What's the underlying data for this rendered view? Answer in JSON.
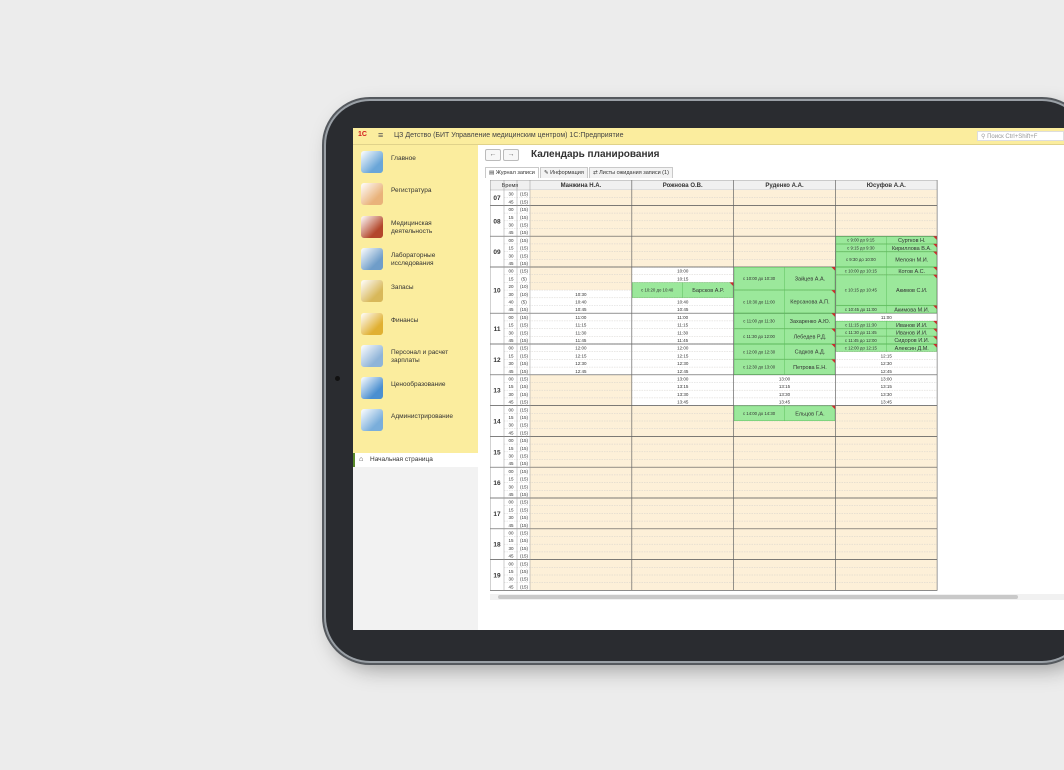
{
  "app": {
    "title": "ЦЗ Детство (БИТ Управление медицинским центром) 1С:Предприятие",
    "search_placeholder": "Поиск Ctrl+Shift+F",
    "logo_text": "1С"
  },
  "sidebar": {
    "items": [
      {
        "label": "Главное",
        "icon": "home-dashboard-icon",
        "color": "#6aa6d8"
      },
      {
        "label": "Регистратура",
        "icon": "nurse-icon",
        "color": "#e9b27a"
      },
      {
        "label": "Медицинская деятельность",
        "icon": "medical-case-icon",
        "color": "#b3472b"
      },
      {
        "label": "Лабораторные исследования",
        "icon": "lab-flask-icon",
        "color": "#6f9dc9"
      },
      {
        "label": "Запасы",
        "icon": "box-icon",
        "color": "#d8b85a"
      },
      {
        "label": "Финансы",
        "icon": "coins-icon",
        "color": "#e0b032"
      },
      {
        "label": "Персонал и расчет зарплаты",
        "icon": "staff-icon",
        "color": "#8fb4d8"
      },
      {
        "label": "Ценообразование",
        "icon": "price-chart-icon",
        "color": "#4b8fd0"
      },
      {
        "label": "Администрирование",
        "icon": "admin-settings-icon",
        "color": "#7aaedb"
      }
    ],
    "home": "Начальная страница"
  },
  "page": {
    "title": "Календарь планирования",
    "back": "←",
    "forward": "→",
    "tabs": [
      {
        "label": "Журнал записи",
        "active": true
      },
      {
        "label": "Информация",
        "active": false
      },
      {
        "label": "Листы ожидания записи (1)",
        "active": false
      }
    ]
  },
  "colors": {
    "free_slot": "#fdf0d8",
    "appointment": "#9be89b",
    "flag": "#cc2b2b",
    "grid_line": "#c8c8c8"
  },
  "schedule": {
    "time_header": "Время",
    "doctors": [
      "Манжина Н.А.",
      "Рожнова О.В.",
      "Руденко А.А.",
      "Юсуфов А.А."
    ],
    "hours": [
      "07",
      "08",
      "09",
      "10",
      "11",
      "12",
      "13",
      "14",
      "15",
      "16",
      "17",
      "18",
      "19"
    ],
    "rows": [
      {
        "h": "07",
        "m": "30",
        "d": "(15)"
      },
      {
        "h": "07",
        "m": "45",
        "d": "(15)"
      },
      {
        "h": "08",
        "m": "00",
        "d": "(15)"
      },
      {
        "h": "08",
        "m": "15",
        "d": "(15)"
      },
      {
        "h": "08",
        "m": "30",
        "d": "(15)"
      },
      {
        "h": "08",
        "m": "45",
        "d": "(15)"
      },
      {
        "h": "09",
        "m": "00",
        "d": "(15)"
      },
      {
        "h": "09",
        "m": "15",
        "d": "(15)"
      },
      {
        "h": "09",
        "m": "30",
        "d": "(15)"
      },
      {
        "h": "09",
        "m": "45",
        "d": "(15)"
      },
      {
        "h": "10",
        "m": "00",
        "d": "(15)"
      },
      {
        "h": "10",
        "m": "15",
        "d": "(5)"
      },
      {
        "h": "10",
        "m": "20",
        "d": "(10)"
      },
      {
        "h": "10",
        "m": "30",
        "d": "(10)"
      },
      {
        "h": "10",
        "m": "40",
        "d": "(5)"
      },
      {
        "h": "10",
        "m": "45",
        "d": "(15)"
      },
      {
        "h": "11",
        "m": "00",
        "d": "(15)"
      },
      {
        "h": "11",
        "m": "15",
        "d": "(15)"
      },
      {
        "h": "11",
        "m": "30",
        "d": "(15)"
      },
      {
        "h": "11",
        "m": "45",
        "d": "(15)"
      },
      {
        "h": "12",
        "m": "00",
        "d": "(15)"
      },
      {
        "h": "12",
        "m": "15",
        "d": "(15)"
      },
      {
        "h": "12",
        "m": "30",
        "d": "(15)"
      },
      {
        "h": "12",
        "m": "45",
        "d": "(15)"
      },
      {
        "h": "13",
        "m": "00",
        "d": "(15)"
      },
      {
        "h": "13",
        "m": "15",
        "d": "(15)"
      },
      {
        "h": "13",
        "m": "30",
        "d": "(15)"
      },
      {
        "h": "13",
        "m": "45",
        "d": "(15)"
      },
      {
        "h": "14",
        "m": "00",
        "d": "(15)"
      },
      {
        "h": "14",
        "m": "15",
        "d": "(15)"
      },
      {
        "h": "14",
        "m": "30",
        "d": "(15)"
      },
      {
        "h": "14",
        "m": "45",
        "d": "(15)"
      },
      {
        "h": "15",
        "m": "00",
        "d": "(15)"
      },
      {
        "h": "15",
        "m": "15",
        "d": "(15)"
      },
      {
        "h": "15",
        "m": "30",
        "d": "(15)"
      },
      {
        "h": "15",
        "m": "45",
        "d": "(15)"
      },
      {
        "h": "16",
        "m": "00",
        "d": "(15)"
      },
      {
        "h": "16",
        "m": "15",
        "d": "(15)"
      },
      {
        "h": "16",
        "m": "30",
        "d": "(15)"
      },
      {
        "h": "16",
        "m": "45",
        "d": "(15)"
      },
      {
        "h": "17",
        "m": "00",
        "d": "(15)"
      },
      {
        "h": "17",
        "m": "15",
        "d": "(15)"
      },
      {
        "h": "17",
        "m": "30",
        "d": "(15)"
      },
      {
        "h": "17",
        "m": "45",
        "d": "(15)"
      },
      {
        "h": "18",
        "m": "00",
        "d": "(15)"
      },
      {
        "h": "18",
        "m": "15",
        "d": "(15)"
      },
      {
        "h": "18",
        "m": "30",
        "d": "(15)"
      },
      {
        "h": "18",
        "m": "45",
        "d": "(15)"
      },
      {
        "h": "19",
        "m": "00",
        "d": "(15)"
      },
      {
        "h": "19",
        "m": "15",
        "d": "(15)"
      },
      {
        "h": "19",
        "m": "30",
        "d": "(15)"
      },
      {
        "h": "19",
        "m": "45",
        "d": "(15)"
      }
    ],
    "free_times": [
      {
        "doctor": 0,
        "row": 13,
        "label": "10:30"
      },
      {
        "doctor": 0,
        "row": 14,
        "label": "10:40"
      },
      {
        "doctor": 0,
        "row": 15,
        "label": "10:45"
      },
      {
        "doctor": 0,
        "row": 16,
        "label": "11:00"
      },
      {
        "doctor": 0,
        "row": 17,
        "label": "11:15"
      },
      {
        "doctor": 0,
        "row": 18,
        "label": "11:30"
      },
      {
        "doctor": 0,
        "row": 19,
        "label": "11:45"
      },
      {
        "doctor": 0,
        "row": 20,
        "label": "12:00"
      },
      {
        "doctor": 0,
        "row": 21,
        "label": "12:15"
      },
      {
        "doctor": 0,
        "row": 22,
        "label": "12:30"
      },
      {
        "doctor": 0,
        "row": 23,
        "label": "12:45"
      },
      {
        "doctor": 1,
        "row": 10,
        "label": "10:00"
      },
      {
        "doctor": 1,
        "row": 11,
        "label": "10:15"
      },
      {
        "doctor": 1,
        "row": 14,
        "label": "10:40"
      },
      {
        "doctor": 1,
        "row": 15,
        "label": "10:45"
      },
      {
        "doctor": 1,
        "row": 16,
        "label": "11:00"
      },
      {
        "doctor": 1,
        "row": 17,
        "label": "11:15"
      },
      {
        "doctor": 1,
        "row": 18,
        "label": "11:30"
      },
      {
        "doctor": 1,
        "row": 19,
        "label": "11:45"
      },
      {
        "doctor": 1,
        "row": 20,
        "label": "12:00"
      },
      {
        "doctor": 1,
        "row": 21,
        "label": "12:15"
      },
      {
        "doctor": 1,
        "row": 22,
        "label": "12:30"
      },
      {
        "doctor": 1,
        "row": 23,
        "label": "12:45"
      },
      {
        "doctor": 1,
        "row": 24,
        "label": "13:00"
      },
      {
        "doctor": 1,
        "row": 25,
        "label": "13:15"
      },
      {
        "doctor": 1,
        "row": 26,
        "label": "13:30"
      },
      {
        "doctor": 1,
        "row": 27,
        "label": "13:45"
      },
      {
        "doctor": 2,
        "row": 24,
        "label": "13:00"
      },
      {
        "doctor": 2,
        "row": 25,
        "label": "13:15"
      },
      {
        "doctor": 2,
        "row": 26,
        "label": "13:30"
      },
      {
        "doctor": 2,
        "row": 27,
        "label": "13:45"
      },
      {
        "doctor": 3,
        "row": 16,
        "label": "11:00"
      },
      {
        "doctor": 3,
        "row": 21,
        "label": "12:15"
      },
      {
        "doctor": 3,
        "row": 22,
        "label": "12:30"
      },
      {
        "doctor": 3,
        "row": 23,
        "label": "12:45"
      },
      {
        "doctor": 3,
        "row": 24,
        "label": "13:00"
      },
      {
        "doctor": 3,
        "row": 25,
        "label": "13:15"
      },
      {
        "doctor": 3,
        "row": 26,
        "label": "13:30"
      },
      {
        "doctor": 3,
        "row": 27,
        "label": "13:45"
      }
    ],
    "appointments": [
      {
        "doctor": 1,
        "start": 12,
        "span": 2,
        "time": "с 10:20 до 10:40",
        "patient": "Барсков А.Р."
      },
      {
        "doctor": 2,
        "start": 10,
        "span": 3,
        "time": "с 10:00 до 10:30",
        "patient": "Зайцев А.А."
      },
      {
        "doctor": 2,
        "start": 13,
        "span": 3,
        "time": "с 10:30 до 11:00",
        "patient": "Керсанова А.П."
      },
      {
        "doctor": 2,
        "start": 16,
        "span": 2,
        "time": "с 11:00 до 11:30",
        "patient": "Захаренко А.Ю."
      },
      {
        "doctor": 2,
        "start": 18,
        "span": 2,
        "time": "с 11:30 до 12:00",
        "patient": "Лебедев Р.Д."
      },
      {
        "doctor": 2,
        "start": 20,
        "span": 2,
        "time": "с 12:00 до 12:30",
        "patient": "Садков А.Д."
      },
      {
        "doctor": 2,
        "start": 22,
        "span": 2,
        "time": "с 12:30 до 13:00",
        "patient": "Петрова Е.Н."
      },
      {
        "doctor": 2,
        "start": 28,
        "span": 2,
        "time": "с 14:00 до 14:30",
        "patient": "Ельцов Г.А."
      },
      {
        "doctor": 3,
        "start": 6,
        "span": 1,
        "time": "с 9:00 до 9:15",
        "patient": "Суртков Н."
      },
      {
        "doctor": 3,
        "start": 7,
        "span": 1,
        "time": "с 9:15 до 9:30",
        "patient": "Кириллова В.А."
      },
      {
        "doctor": 3,
        "start": 8,
        "span": 2,
        "time": "с 9:30 до 10:00",
        "patient": "Мелоян М.И."
      },
      {
        "doctor": 3,
        "start": 10,
        "span": 1,
        "time": "с 10:00 до 10:15",
        "patient": "Котов А.С."
      },
      {
        "doctor": 3,
        "start": 11,
        "span": 4,
        "time": "с 10:15 до 10:45",
        "patient": "Акимов С.И."
      },
      {
        "doctor": 3,
        "start": 15,
        "span": 1,
        "time": "с 10:45 до 11:00",
        "patient": "Акимова М.И."
      },
      {
        "doctor": 3,
        "start": 17,
        "span": 1,
        "time": "с 11:15 до 11:30",
        "patient": "Иванов И.И."
      },
      {
        "doctor": 3,
        "start": 18,
        "span": 1,
        "time": "с 11:30 до 11:45",
        "patient": "Иванов И.И."
      },
      {
        "doctor": 3,
        "start": 19,
        "span": 1,
        "time": "с 11:45 до 12:00",
        "patient": "Сидоров И.И."
      },
      {
        "doctor": 3,
        "start": 20,
        "span": 1,
        "time": "с 12:00 до 12:15",
        "patient": "Алексин Д.М."
      }
    ]
  }
}
